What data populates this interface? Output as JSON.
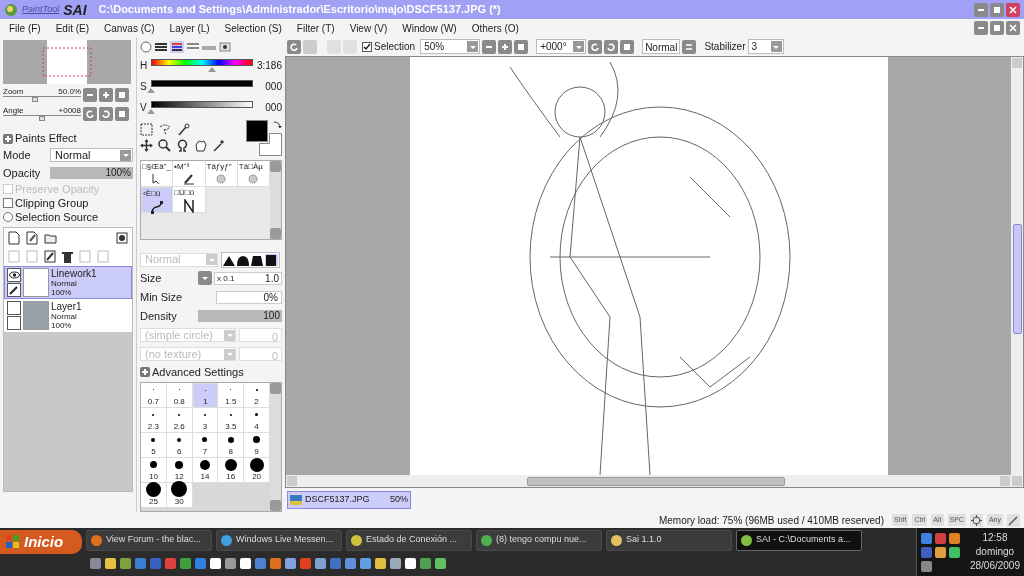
{
  "window": {
    "logo_small": "PaintTool",
    "logo_big": "SAI",
    "title": "C:\\Documents and Settings\\Administrador\\Escritorio\\majo\\DSCF5137.JPG (*)"
  },
  "menu": [
    "File (F)",
    "Edit (E)",
    "Canvas (C)",
    "Layer (L)",
    "Selection (S)",
    "Filter (T)",
    "View (V)",
    "Window (W)",
    "Others (O)"
  ],
  "navigator": {
    "zoom": {
      "label": "Zoom",
      "value": "50.0%",
      "level": 0.4
    },
    "angle": {
      "label": "Angle",
      "value": "+0008",
      "level": 0.5
    }
  },
  "paints_effect": {
    "title": "Paints Effect",
    "mode_label": "Mode",
    "mode": "Normal",
    "opacity": {
      "label": "Opacity",
      "value": "100%",
      "level": 1
    }
  },
  "options": [
    {
      "kind": "checkbox",
      "label": "Preserve Opacity",
      "checked": false,
      "disabled": true
    },
    {
      "kind": "checkbox",
      "label": "Clipping Group",
      "checked": false,
      "disabled": false
    },
    {
      "kind": "radio",
      "label": "Selection Source",
      "checked": false,
      "disabled": false
    }
  ],
  "layers": [
    {
      "name": "Linework1",
      "mode": "Normal",
      "opacity": "100%",
      "selected": true,
      "visible": true
    },
    {
      "name": "Layer1",
      "mode": "Normal",
      "opacity": "100%",
      "selected": false,
      "visible": false
    }
  ],
  "color": [
    {
      "label": "H",
      "value": "3:186",
      "level": 0.6
    },
    {
      "label": "S",
      "value": "000",
      "level": 0
    },
    {
      "label": "V",
      "value": "000",
      "level": 0
    }
  ],
  "tools": [
    {
      "label": "□§Œä\"_",
      "selected": false
    },
    {
      "label": "▪M˘³",
      "selected": false
    },
    {
      "label": "Tâƒyƒ\"",
      "selected": false
    },
    {
      "label": "Tâ□Àµ",
      "selected": false
    },
    {
      "label": "‹È□ü",
      "selected": true
    },
    {
      "label": "□Ü□ü",
      "selected": false
    }
  ],
  "brush": {
    "blend": "Normal",
    "size_label": "Size",
    "size_multiplier": "x 0.1",
    "size": "1.0",
    "min_size_label": "Min Size",
    "min_size": "0%",
    "density": {
      "label": "Density",
      "value": "100",
      "level": 1
    },
    "shape": "(simple circle)",
    "shape_value": "0",
    "texture": "(no texture)",
    "texture_value": "0",
    "advanced": "Advanced Settings"
  },
  "brush_sizes": [
    {
      "label": "0.7",
      "selected": false
    },
    {
      "label": "0.8",
      "selected": false
    },
    {
      "label": "1",
      "selected": true
    },
    {
      "label": "1.5",
      "selected": false
    },
    {
      "label": "2",
      "selected": false
    },
    {
      "label": "2.3",
      "selected": false
    },
    {
      "label": "2.6",
      "selected": false
    },
    {
      "label": "3",
      "selected": false
    },
    {
      "label": "3.5",
      "selected": false
    },
    {
      "label": "4",
      "selected": false
    },
    {
      "label": "5",
      "selected": false
    },
    {
      "label": "6",
      "selected": false
    },
    {
      "label": "7",
      "selected": false
    },
    {
      "label": "8",
      "selected": false
    },
    {
      "label": "9",
      "selected": false
    },
    {
      "label": "10",
      "selected": false
    },
    {
      "label": "12",
      "selected": false
    },
    {
      "label": "14",
      "selected": false
    },
    {
      "label": "16",
      "selected": false
    },
    {
      "label": "20",
      "selected": false
    },
    {
      "label": "25",
      "selected": false
    },
    {
      "label": "30",
      "selected": false
    }
  ],
  "toolbar": {
    "selection_label": "Selection",
    "selection_checked": true,
    "zoom": "50%",
    "angle": "+000°",
    "blend": "Normal",
    "stabilizer_label": "Stabilizer",
    "stabilizer": "3"
  },
  "canvas_tabs": [
    {
      "name": "DSCF5137.JPG",
      "zoom": "50%",
      "selected": true
    }
  ],
  "status": {
    "memory": "Memory load: 75% (96MB used / 410MB reserved)",
    "keys": [
      "Shft",
      "Ctrl",
      "Alt",
      "SPC",
      "Any"
    ]
  },
  "taskbar": {
    "start": "Inicio",
    "tasks": [
      {
        "label": "View Forum - the blac...",
        "selected": false
      },
      {
        "label": "Windows Live Messen...",
        "selected": false
      },
      {
        "label": "Estado de Conexión ...",
        "selected": false
      },
      {
        "label": "(8) tengo compu nue...",
        "selected": false
      },
      {
        "label": "Sai 1.1.0",
        "selected": false
      },
      {
        "label": "SAI - C:\\Documents a...",
        "selected": true
      }
    ],
    "time": "12:58",
    "day": "domingo",
    "date": "28/06/2009"
  }
}
